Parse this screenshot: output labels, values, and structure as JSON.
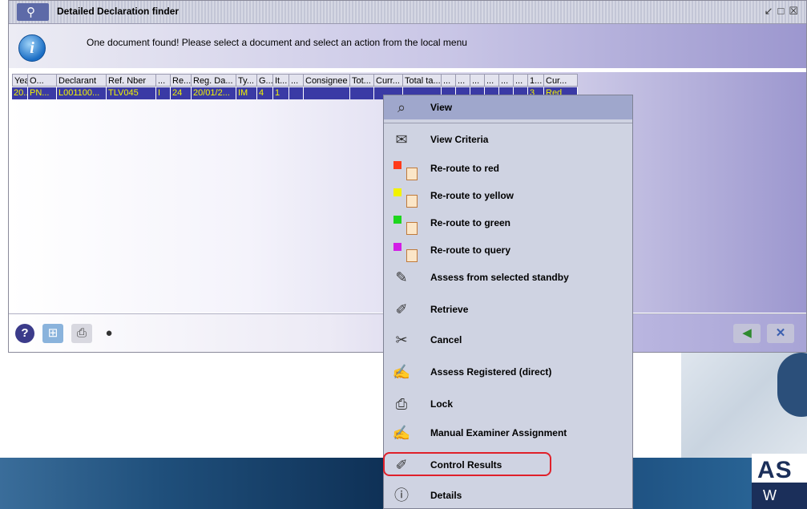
{
  "window": {
    "title": "Detailed Declaration finder",
    "info_message": "One document found! Please select a document and select an action from the local menu"
  },
  "grid": {
    "columns": [
      "Year",
      "O...",
      "Declarant",
      "Ref. Nber",
      "...",
      "Re...",
      "Reg. Da...",
      "Ty...",
      "G...",
      "It...",
      "...",
      "Consignee",
      "Tot...",
      "Curr...",
      "Total ta...",
      "...",
      "...",
      "...",
      "...",
      "...",
      "...",
      "1...",
      "Cur..."
    ],
    "row": [
      "20...",
      "PN...",
      "L001100...",
      "TLV045",
      "I",
      "24",
      "20/01/2...",
      "IM",
      "4",
      "1",
      "",
      "",
      "",
      "",
      "",
      "",
      "",
      "",
      "",
      "",
      "",
      "3",
      "Red"
    ]
  },
  "menu": {
    "items": [
      {
        "label": "View",
        "icon": "view-icon"
      },
      {
        "label": "View Criteria",
        "icon": "criteria-icon"
      },
      {
        "label": "Re-route to red",
        "icon": "reroute-red-icon",
        "color": "#ff3b1a"
      },
      {
        "label": "Re-route to yellow",
        "icon": "reroute-yellow-icon",
        "color": "#f2f200"
      },
      {
        "label": "Re-route to green",
        "icon": "reroute-green-icon",
        "color": "#1ed61e"
      },
      {
        "label": "Re-route to query",
        "icon": "reroute-query-icon",
        "color": "#d21ee6"
      },
      {
        "label": "Assess from selected standby",
        "icon": "assess-standby-icon"
      },
      {
        "label": "Retrieve",
        "icon": "retrieve-icon"
      },
      {
        "label": "Cancel",
        "icon": "cancel-icon"
      },
      {
        "label": "Assess Registered (direct)",
        "icon": "assess-registered-icon"
      },
      {
        "label": "Lock",
        "icon": "lock-icon"
      },
      {
        "label": "Manual Examiner Assignment",
        "icon": "examiner-icon"
      },
      {
        "label": "Control Results",
        "icon": "control-results-icon"
      },
      {
        "label": "Details",
        "icon": "details-icon"
      }
    ]
  },
  "toolbar": {
    "help_icon": "help-icon",
    "filter_icon": "filter-icon",
    "print_icon": "print-icon",
    "traffic_light_icon": "traffic-light-icon",
    "back_icon": "back-arrow-icon",
    "close_icon": "close-icon"
  },
  "brand": {
    "top": "AS",
    "bottom": "W"
  }
}
